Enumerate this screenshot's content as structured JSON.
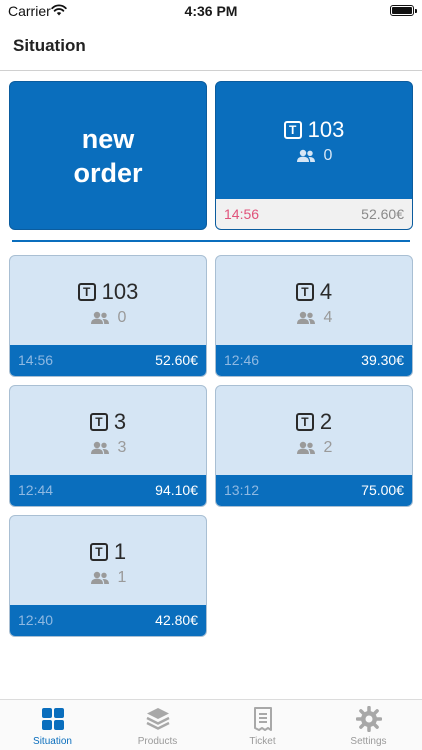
{
  "status_bar": {
    "carrier": "Carrier",
    "time": "4:36 PM"
  },
  "nav": {
    "title": "Situation"
  },
  "new_order": {
    "label": "new order"
  },
  "current_order": {
    "table_prefix": "T",
    "table": "103",
    "guests": "0",
    "time": "14:56",
    "amount": "52.60€"
  },
  "tables": [
    {
      "table_prefix": "T",
      "table": "103",
      "guests": "0",
      "time": "14:56",
      "amount": "52.60€"
    },
    {
      "table_prefix": "T",
      "table": "4",
      "guests": "4",
      "time": "12:46",
      "amount": "39.30€"
    },
    {
      "table_prefix": "T",
      "table": "3",
      "guests": "3",
      "time": "12:44",
      "amount": "94.10€"
    },
    {
      "table_prefix": "T",
      "table": "2",
      "guests": "2",
      "time": "13:12",
      "amount": "75.00€"
    },
    {
      "table_prefix": "T",
      "table": "1",
      "guests": "1",
      "time": "12:40",
      "amount": "42.80€"
    }
  ],
  "tab_bar": {
    "items": [
      {
        "label": "Situation",
        "icon": "grid-icon",
        "active": true
      },
      {
        "label": "Products",
        "icon": "layers-icon",
        "active": false
      },
      {
        "label": "Ticket",
        "icon": "receipt-icon",
        "active": false
      },
      {
        "label": "Settings",
        "icon": "gear-icon",
        "active": false
      }
    ]
  },
  "colors": {
    "accent": "#0a6ebd",
    "card_bg": "#d5e5f4",
    "time_alert": "#e0527a"
  }
}
